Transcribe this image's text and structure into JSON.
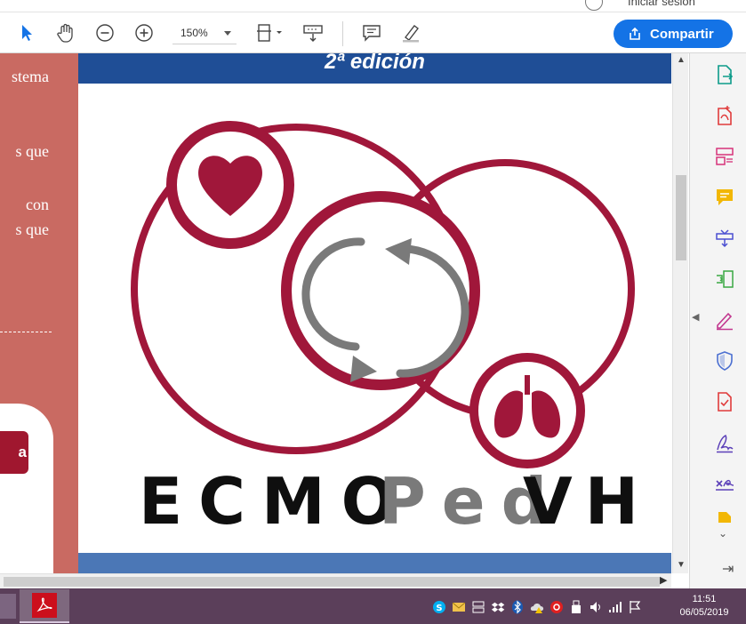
{
  "window": {
    "signin_label": "Iniciar sesión"
  },
  "toolbar": {
    "zoom_value": "150%",
    "share_label": "Compartir"
  },
  "left_page": {
    "lines": [
      "stema",
      "s que",
      "con",
      "s  que"
    ],
    "card_button_label": "a"
  },
  "document": {
    "banner_text": "2ª edición",
    "logo_text": {
      "ecmo": "ECMO",
      "ped": "Ped",
      "vh": "VH"
    },
    "colors": {
      "crimson": "#a0173a",
      "gray": "#7a7a7a",
      "banner_blue": "#1f4e96"
    }
  },
  "right_panel": {
    "tools": [
      "export-pdf-icon",
      "create-pdf-icon",
      "organize-pages-icon",
      "comment-icon",
      "combine-files-icon",
      "compress-icon",
      "fill-sign-icon",
      "protect-icon",
      "send-track-icon",
      "sign-icon",
      "request-signature-icon",
      "more-tools-icon"
    ]
  },
  "taskbar": {
    "time": "11:51",
    "date": "06/05/2019",
    "tray_icons": [
      "skype-icon",
      "mail-icon",
      "network-drive-icon",
      "dropbox-icon",
      "bluetooth-icon",
      "warning-cloud-icon",
      "antivirus-icon",
      "usb-icon",
      "volume-icon",
      "signal-icon",
      "flag-icon"
    ]
  }
}
